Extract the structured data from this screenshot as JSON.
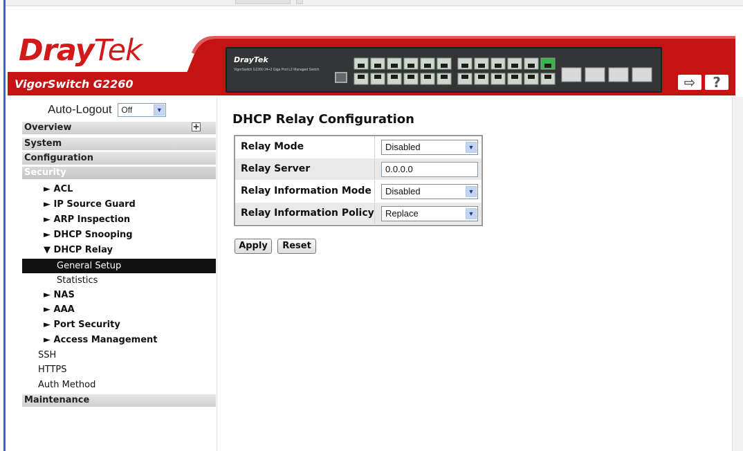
{
  "brand": {
    "logo_left": "Dray",
    "logo_right": "Tek",
    "model": "VigorSwitch G2260",
    "panel_logo": "DrayTek",
    "panel_sub": "VigorSwitch G2260\n24+2 Giga Port L2 Managed Switch",
    "accent_color": "#c51212"
  },
  "header_icons": {
    "logout": "logout-icon",
    "help": "?"
  },
  "sidebar": {
    "autologout_label": "Auto-Logout",
    "autologout_value": "Off",
    "sections": [
      "Overview",
      "System",
      "Configuration",
      "Security",
      "Maintenance"
    ],
    "security_items": {
      "acl": "► ACL",
      "ip_source_guard": "► IP Source Guard",
      "arp_inspection": "► ARP Inspection",
      "dhcp_snooping": "► DHCP Snooping",
      "dhcp_relay": "▼ DHCP Relay",
      "general_setup": "General Setup",
      "statistics": "Statistics",
      "nas": "► NAS",
      "aaa": "► AAA",
      "port_security": "► Port Security",
      "access_management": "► Access Management",
      "ssh": "SSH",
      "https": "HTTPS",
      "auth_method": "Auth Method"
    }
  },
  "main": {
    "title": "DHCP Relay Configuration",
    "rows": [
      {
        "label": "Relay Mode",
        "value": "Disabled",
        "type": "select"
      },
      {
        "label": "Relay Server",
        "value": "0.0.0.0",
        "type": "input"
      },
      {
        "label": "Relay Information Mode",
        "value": "Disabled",
        "type": "select"
      },
      {
        "label": "Relay Information Policy",
        "value": "Replace",
        "type": "select"
      }
    ],
    "apply_label": "Apply",
    "reset_label": "Reset"
  }
}
